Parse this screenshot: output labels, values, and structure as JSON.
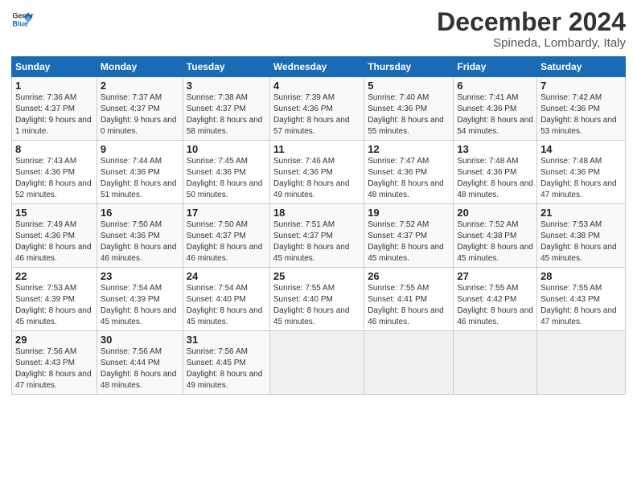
{
  "logo": {
    "text_general": "General",
    "text_blue": "Blue"
  },
  "header": {
    "title": "December 2024",
    "subtitle": "Spineda, Lombardy, Italy"
  },
  "days_of_week": [
    "Sunday",
    "Monday",
    "Tuesday",
    "Wednesday",
    "Thursday",
    "Friday",
    "Saturday"
  ],
  "weeks": [
    [
      {
        "day": "1",
        "sunrise": "Sunrise: 7:36 AM",
        "sunset": "Sunset: 4:37 PM",
        "daylight": "Daylight: 9 hours and 1 minute."
      },
      {
        "day": "2",
        "sunrise": "Sunrise: 7:37 AM",
        "sunset": "Sunset: 4:37 PM",
        "daylight": "Daylight: 9 hours and 0 minutes."
      },
      {
        "day": "3",
        "sunrise": "Sunrise: 7:38 AM",
        "sunset": "Sunset: 4:37 PM",
        "daylight": "Daylight: 8 hours and 58 minutes."
      },
      {
        "day": "4",
        "sunrise": "Sunrise: 7:39 AM",
        "sunset": "Sunset: 4:36 PM",
        "daylight": "Daylight: 8 hours and 57 minutes."
      },
      {
        "day": "5",
        "sunrise": "Sunrise: 7:40 AM",
        "sunset": "Sunset: 4:36 PM",
        "daylight": "Daylight: 8 hours and 55 minutes."
      },
      {
        "day": "6",
        "sunrise": "Sunrise: 7:41 AM",
        "sunset": "Sunset: 4:36 PM",
        "daylight": "Daylight: 8 hours and 54 minutes."
      },
      {
        "day": "7",
        "sunrise": "Sunrise: 7:42 AM",
        "sunset": "Sunset: 4:36 PM",
        "daylight": "Daylight: 8 hours and 53 minutes."
      }
    ],
    [
      {
        "day": "8",
        "sunrise": "Sunrise: 7:43 AM",
        "sunset": "Sunset: 4:36 PM",
        "daylight": "Daylight: 8 hours and 52 minutes."
      },
      {
        "day": "9",
        "sunrise": "Sunrise: 7:44 AM",
        "sunset": "Sunset: 4:36 PM",
        "daylight": "Daylight: 8 hours and 51 minutes."
      },
      {
        "day": "10",
        "sunrise": "Sunrise: 7:45 AM",
        "sunset": "Sunset: 4:36 PM",
        "daylight": "Daylight: 8 hours and 50 minutes."
      },
      {
        "day": "11",
        "sunrise": "Sunrise: 7:46 AM",
        "sunset": "Sunset: 4:36 PM",
        "daylight": "Daylight: 8 hours and 49 minutes."
      },
      {
        "day": "12",
        "sunrise": "Sunrise: 7:47 AM",
        "sunset": "Sunset: 4:36 PM",
        "daylight": "Daylight: 8 hours and 48 minutes."
      },
      {
        "day": "13",
        "sunrise": "Sunrise: 7:48 AM",
        "sunset": "Sunset: 4:36 PM",
        "daylight": "Daylight: 8 hours and 48 minutes."
      },
      {
        "day": "14",
        "sunrise": "Sunrise: 7:48 AM",
        "sunset": "Sunset: 4:36 PM",
        "daylight": "Daylight: 8 hours and 47 minutes."
      }
    ],
    [
      {
        "day": "15",
        "sunrise": "Sunrise: 7:49 AM",
        "sunset": "Sunset: 4:36 PM",
        "daylight": "Daylight: 8 hours and 46 minutes."
      },
      {
        "day": "16",
        "sunrise": "Sunrise: 7:50 AM",
        "sunset": "Sunset: 4:36 PM",
        "daylight": "Daylight: 8 hours and 46 minutes."
      },
      {
        "day": "17",
        "sunrise": "Sunrise: 7:50 AM",
        "sunset": "Sunset: 4:37 PM",
        "daylight": "Daylight: 8 hours and 46 minutes."
      },
      {
        "day": "18",
        "sunrise": "Sunrise: 7:51 AM",
        "sunset": "Sunset: 4:37 PM",
        "daylight": "Daylight: 8 hours and 45 minutes."
      },
      {
        "day": "19",
        "sunrise": "Sunrise: 7:52 AM",
        "sunset": "Sunset: 4:37 PM",
        "daylight": "Daylight: 8 hours and 45 minutes."
      },
      {
        "day": "20",
        "sunrise": "Sunrise: 7:52 AM",
        "sunset": "Sunset: 4:38 PM",
        "daylight": "Daylight: 8 hours and 45 minutes."
      },
      {
        "day": "21",
        "sunrise": "Sunrise: 7:53 AM",
        "sunset": "Sunset: 4:38 PM",
        "daylight": "Daylight: 8 hours and 45 minutes."
      }
    ],
    [
      {
        "day": "22",
        "sunrise": "Sunrise: 7:53 AM",
        "sunset": "Sunset: 4:39 PM",
        "daylight": "Daylight: 8 hours and 45 minutes."
      },
      {
        "day": "23",
        "sunrise": "Sunrise: 7:54 AM",
        "sunset": "Sunset: 4:39 PM",
        "daylight": "Daylight: 8 hours and 45 minutes."
      },
      {
        "day": "24",
        "sunrise": "Sunrise: 7:54 AM",
        "sunset": "Sunset: 4:40 PM",
        "daylight": "Daylight: 8 hours and 45 minutes."
      },
      {
        "day": "25",
        "sunrise": "Sunrise: 7:55 AM",
        "sunset": "Sunset: 4:40 PM",
        "daylight": "Daylight: 8 hours and 45 minutes."
      },
      {
        "day": "26",
        "sunrise": "Sunrise: 7:55 AM",
        "sunset": "Sunset: 4:41 PM",
        "daylight": "Daylight: 8 hours and 46 minutes."
      },
      {
        "day": "27",
        "sunrise": "Sunrise: 7:55 AM",
        "sunset": "Sunset: 4:42 PM",
        "daylight": "Daylight: 8 hours and 46 minutes."
      },
      {
        "day": "28",
        "sunrise": "Sunrise: 7:55 AM",
        "sunset": "Sunset: 4:43 PM",
        "daylight": "Daylight: 8 hours and 47 minutes."
      }
    ],
    [
      {
        "day": "29",
        "sunrise": "Sunrise: 7:56 AM",
        "sunset": "Sunset: 4:43 PM",
        "daylight": "Daylight: 8 hours and 47 minutes."
      },
      {
        "day": "30",
        "sunrise": "Sunrise: 7:56 AM",
        "sunset": "Sunset: 4:44 PM",
        "daylight": "Daylight: 8 hours and 48 minutes."
      },
      {
        "day": "31",
        "sunrise": "Sunrise: 7:56 AM",
        "sunset": "Sunset: 4:45 PM",
        "daylight": "Daylight: 8 hours and 49 minutes."
      },
      null,
      null,
      null,
      null
    ]
  ]
}
